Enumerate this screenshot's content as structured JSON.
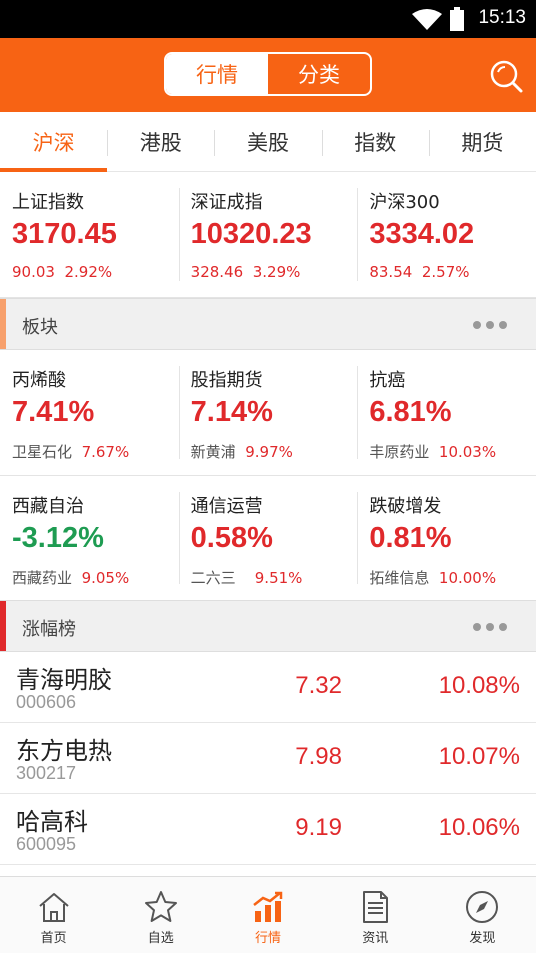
{
  "status": {
    "time": "15:13"
  },
  "header": {
    "segments": [
      "行情",
      "分类"
    ]
  },
  "tabs": [
    "沪深",
    "港股",
    "美股",
    "指数",
    "期货"
  ],
  "indices": [
    {
      "name": "上证指数",
      "value": "3170.45",
      "change": "90.03",
      "pct": "2.92%"
    },
    {
      "name": "深证成指",
      "value": "10320.23",
      "change": "328.46",
      "pct": "3.29%"
    },
    {
      "name": "沪深300",
      "value": "3334.02",
      "change": "83.54",
      "pct": "2.57%"
    }
  ],
  "sectors_header": "板块",
  "sectors": [
    {
      "name": "丙烯酸",
      "pct": "7.41%",
      "stock": "卫星石化",
      "stock_pct": "7.67%"
    },
    {
      "name": "股指期货",
      "pct": "7.14%",
      "stock": "新黄浦",
      "stock_pct": "9.97%"
    },
    {
      "name": "抗癌",
      "pct": "6.81%",
      "stock": "丰原药业",
      "stock_pct": "10.03%"
    },
    {
      "name": "西藏自治",
      "pct": "-3.12%",
      "stock": "西藏药业",
      "stock_pct": "9.05%"
    },
    {
      "name": "通信运营",
      "pct": "0.58%",
      "stock": "二六三",
      "stock_pct": "9.51%"
    },
    {
      "name": "跌破增发",
      "pct": "0.81%",
      "stock": "拓维信息",
      "stock_pct": "10.00%"
    }
  ],
  "gainers_header": "涨幅榜",
  "gainers": [
    {
      "name": "青海明胶",
      "code": "000606",
      "price": "7.32",
      "pct": "10.08%"
    },
    {
      "name": "东方电热",
      "code": "300217",
      "price": "7.98",
      "pct": "10.07%"
    },
    {
      "name": "哈高科",
      "code": "600095",
      "price": "9.19",
      "pct": "10.06%"
    }
  ],
  "nav": [
    {
      "label": "首页",
      "icon": "home-icon"
    },
    {
      "label": "自选",
      "icon": "star-icon"
    },
    {
      "label": "行情",
      "icon": "market-chart-icon"
    },
    {
      "label": "资讯",
      "icon": "news-icon"
    },
    {
      "label": "发现",
      "icon": "compass-icon"
    }
  ],
  "colors": {
    "accent": "#f76314",
    "up": "#e0292b",
    "down": "#1e9c52"
  }
}
